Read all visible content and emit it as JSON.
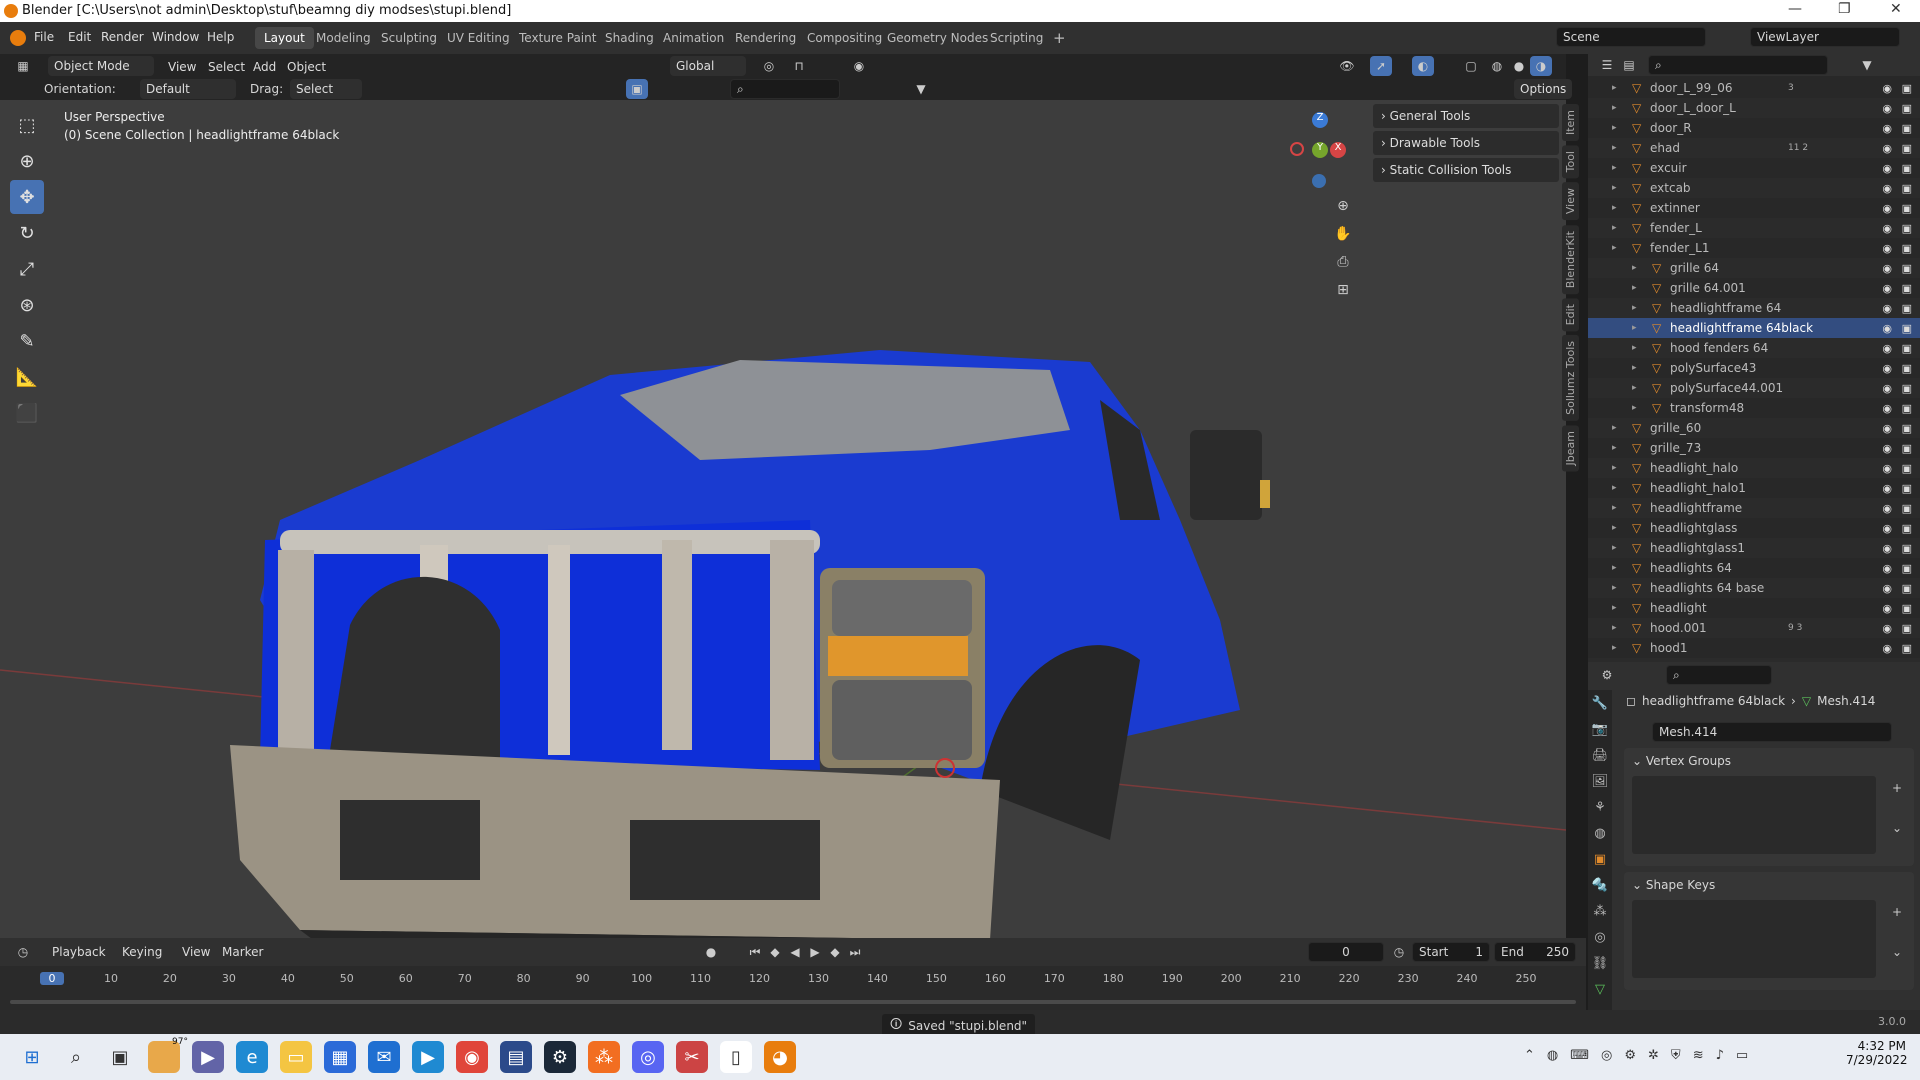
{
  "window": {
    "title": "Blender [C:\\Users\\not admin\\Desktop\\stuf\\beamng diy modses\\stupi.blend]",
    "minimize": "—",
    "maximize": "❐",
    "close": "✕"
  },
  "menu": [
    "File",
    "Edit",
    "Render",
    "Window",
    "Help"
  ],
  "workspaces": [
    "Layout",
    "Modeling",
    "Sculpting",
    "UV Editing",
    "Texture Paint",
    "Shading",
    "Animation",
    "Rendering",
    "Compositing",
    "Geometry Nodes",
    "Scripting"
  ],
  "workspace_add": "+",
  "scene": {
    "name": "Scene",
    "view_layer": "ViewLayer"
  },
  "viewport_header": {
    "mode": "Object Mode",
    "menus": [
      "View",
      "Select",
      "Add",
      "Object"
    ],
    "transform": "Global",
    "orientation_label": "Orientation:",
    "orientation": "Default",
    "drag_label": "Drag:",
    "drag": "Select Box",
    "options": "Options"
  },
  "viewport": {
    "perspective": "User Perspective",
    "collection": "(0) Scene Collection | headlightframe 64black",
    "gizmo_z": "Z",
    "gizmo_y": "Y",
    "gizmo_x": "X"
  },
  "npanel": {
    "sections": [
      "General Tools",
      "Drawable Tools",
      "Static Collision Tools"
    ],
    "tabs": [
      "Item",
      "Tool",
      "View",
      "BlenderKit",
      "Edit",
      "Sollumz Tools",
      "Jbeam"
    ]
  },
  "outliner": {
    "rows": [
      {
        "name": "door_L_99_06",
        "indent": 0,
        "badge": "3"
      },
      {
        "name": "door_L_door_L",
        "indent": 0,
        "badge": ""
      },
      {
        "name": "door_R",
        "indent": 0,
        "badge": ""
      },
      {
        "name": "ehad",
        "indent": 0,
        "badge": "11 2"
      },
      {
        "name": "excuir",
        "indent": 0,
        "badge": ""
      },
      {
        "name": "extcab",
        "indent": 0,
        "badge": ""
      },
      {
        "name": "extinner",
        "indent": 0,
        "badge": ""
      },
      {
        "name": "fender_L",
        "indent": 0,
        "badge": ""
      },
      {
        "name": "fender_L1",
        "indent": 0,
        "badge": ""
      },
      {
        "name": "grille 64",
        "indent": 1,
        "badge": ""
      },
      {
        "name": "grille 64.001",
        "indent": 1,
        "badge": ""
      },
      {
        "name": "headlightframe 64",
        "indent": 1,
        "badge": ""
      },
      {
        "name": "headlightframe 64black",
        "indent": 1,
        "badge": ""
      },
      {
        "name": "hood fenders 64",
        "indent": 1,
        "badge": ""
      },
      {
        "name": "polySurface43",
        "indent": 1,
        "badge": ""
      },
      {
        "name": "polySurface44.001",
        "indent": 1,
        "badge": ""
      },
      {
        "name": "transform48",
        "indent": 1,
        "badge": ""
      },
      {
        "name": "grille_60",
        "indent": 0,
        "badge": ""
      },
      {
        "name": "grille_73",
        "indent": 0,
        "badge": ""
      },
      {
        "name": "headlight_halo",
        "indent": 0,
        "badge": ""
      },
      {
        "name": "headlight_halo1",
        "indent": 0,
        "badge": ""
      },
      {
        "name": "headlightframe",
        "indent": 0,
        "badge": ""
      },
      {
        "name": "headlightglass",
        "indent": 0,
        "badge": ""
      },
      {
        "name": "headlightglass1",
        "indent": 0,
        "badge": ""
      },
      {
        "name": "headlights 64",
        "indent": 0,
        "badge": ""
      },
      {
        "name": "headlights 64 base",
        "indent": 0,
        "badge": ""
      },
      {
        "name": "headlight",
        "indent": 0,
        "badge": ""
      },
      {
        "name": "hood.001",
        "indent": 0,
        "badge": "9 3"
      },
      {
        "name": "hood1",
        "indent": 0,
        "badge": ""
      },
      {
        "name": "hood2",
        "indent": 0,
        "badge": ""
      }
    ],
    "selected": "headlightframe 64black"
  },
  "properties": {
    "object": "headlightframe 64black",
    "mesh": "Mesh.414",
    "mesh_field": "Mesh.414",
    "panels": [
      "Vertex Groups",
      "Shape Keys"
    ]
  },
  "timeline": {
    "menus": [
      "Playback",
      "Keying",
      "View",
      "Marker"
    ],
    "current_frame": "0",
    "start_label": "Start",
    "start": "1",
    "end_label": "End",
    "end": "250",
    "ticks": [
      "0",
      "10",
      "20",
      "30",
      "40",
      "50",
      "60",
      "70",
      "80",
      "90",
      "100",
      "110",
      "120",
      "130",
      "140",
      "150",
      "160",
      "170",
      "180",
      "190",
      "200",
      "210",
      "220",
      "230",
      "240",
      "250"
    ]
  },
  "status": {
    "message": "Saved \"stupi.blend\"",
    "version": "3.0.0"
  },
  "taskbar": {
    "time": "4:32 PM",
    "date": "7/29/2022",
    "weather": "97°"
  }
}
